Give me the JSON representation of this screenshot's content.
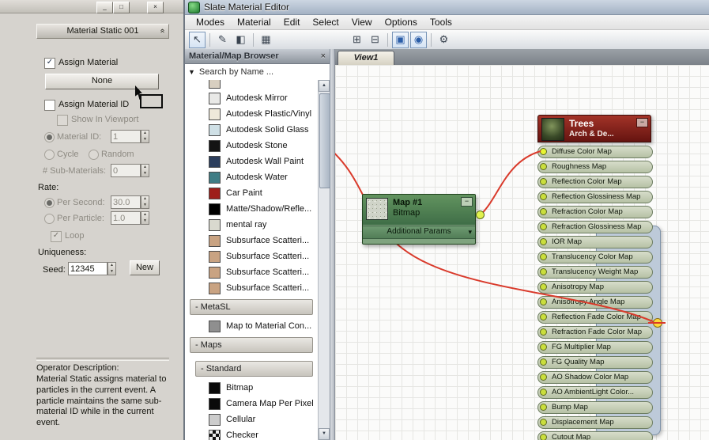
{
  "icons": {
    "check": "✓",
    "collapse_chevron": "«",
    "minus": "−",
    "spinner_up": "▲",
    "spinner_down": "▼",
    "filter_arrow": "▼",
    "close_x": "×",
    "window_minimize": "_",
    "window_maximize": "□",
    "window_close": "×",
    "expand_arrow": "▾",
    "scroll_up": "▲",
    "scroll_down": "▼"
  },
  "left_panel": {
    "rollout_title": "Material Static 001",
    "assign_material": "Assign Material",
    "none_button": "None",
    "assign_material_id": "Assign Material ID",
    "show_in_viewport": "Show In Viewport",
    "material_id_label": "Material ID:",
    "material_id_value": "1",
    "cycle": "Cycle",
    "random": "Random",
    "sub_materials_label": "# Sub-Materials:",
    "sub_materials_value": "0",
    "rate_label": "Rate:",
    "per_second": "Per Second:",
    "per_second_value": "30.0",
    "per_particle": "Per Particle:",
    "per_particle_value": "1.0",
    "loop": "Loop",
    "uniqueness_label": "Uniqueness:",
    "seed_label": "Seed:",
    "seed_value": "12345",
    "new_button": "New",
    "description_title": "Operator Description:",
    "description_text": "Material Static assigns material to particles in the current event.  A particle maintains the same sub-material ID while in the current event."
  },
  "window": {
    "title": "Slate Material Editor"
  },
  "menubar": [
    "Modes",
    "Material",
    "Edit",
    "Select",
    "View",
    "Options",
    "Tools"
  ],
  "toolbar": [
    {
      "name": "select-tool",
      "glyph": "↖",
      "active": true
    },
    {
      "sep": true
    },
    {
      "name": "pick-material-from-object",
      "glyph": "✎"
    },
    {
      "name": "assign-material-to-selection",
      "glyph": "◧"
    },
    {
      "sep": true
    },
    {
      "name": "put-to-library",
      "glyph": "▦"
    },
    {
      "gap": true
    },
    {
      "name": "layout-all",
      "glyph": "⊞"
    },
    {
      "name": "layout-children",
      "glyph": "⊟"
    },
    {
      "sep": true
    },
    {
      "name": "show-shaded-material-in-viewport",
      "glyph": "▣",
      "active": true,
      "blue": true
    },
    {
      "name": "show-end-result",
      "glyph": "◉",
      "active": true,
      "blue": true
    },
    {
      "sep": true
    },
    {
      "name": "options-gear",
      "glyph": "⚙"
    }
  ],
  "browser": {
    "title": "Material/Map Browser",
    "search_text": "Search by Name ...",
    "items": [
      {
        "type": "item",
        "partial": true,
        "label": "",
        "icon": "material-sphere-icon",
        "color": "#d8cfc0"
      },
      {
        "type": "item",
        "label": "Autodesk Mirror",
        "icon": "material-sphere-icon",
        "color": "#e9e9e7"
      },
      {
        "type": "item",
        "label": "Autodesk Plastic/Vinyl",
        "icon": "material-sphere-icon",
        "color": "#efe9da"
      },
      {
        "type": "item",
        "label": "Autodesk Solid Glass",
        "icon": "material-sphere-icon",
        "color": "#cfe0e6"
      },
      {
        "type": "item",
        "label": "Autodesk Stone",
        "icon": "material-sphere-icon",
        "color": "#141414"
      },
      {
        "type": "item",
        "label": "Autodesk Wall Paint",
        "icon": "material-sphere-icon",
        "color": "#2c3e5c"
      },
      {
        "type": "item",
        "label": "Autodesk Water",
        "icon": "material-sphere-icon",
        "color": "#3f7d85"
      },
      {
        "type": "item",
        "label": "Car Paint",
        "icon": "material-sphere-icon",
        "color": "#9e1f1a"
      },
      {
        "type": "item",
        "label": "Matte/Shadow/Refle...",
        "icon": "material-sphere-icon",
        "color": "#000000"
      },
      {
        "type": "item",
        "label": "mental ray",
        "icon": "material-sphere-icon",
        "color": "#d9d9cf"
      },
      {
        "type": "item",
        "label": "Subsurface Scatteri...",
        "icon": "material-sphere-icon",
        "color": "#c9a382"
      },
      {
        "type": "item",
        "label": "Subsurface Scatteri...",
        "icon": "material-sphere-icon",
        "color": "#c9a382"
      },
      {
        "type": "item",
        "label": "Subsurface Scatteri...",
        "icon": "material-sphere-icon",
        "color": "#c9a382"
      },
      {
        "type": "item",
        "label": "Subsurface Scatteri...",
        "icon": "material-sphere-icon",
        "color": "#c9a382"
      },
      {
        "type": "group",
        "label": "- MetaSL"
      },
      {
        "type": "item",
        "label": "Map to Material Con...",
        "icon": "map-icon",
        "color": "#8f8f8f"
      },
      {
        "type": "group",
        "label": "- Maps"
      },
      {
        "type": "group",
        "label": "- Standard",
        "indent": true,
        "spaced": true
      },
      {
        "type": "item",
        "label": "Bitmap",
        "icon": "map-icon",
        "color": "#0a0a0a"
      },
      {
        "type": "item",
        "label": "Camera Map Per Pixel",
        "icon": "map-icon",
        "color": "#0a0a0a"
      },
      {
        "type": "item",
        "label": "Cellular",
        "icon": "map-icon",
        "color": "#cccccc"
      },
      {
        "type": "item",
        "label": "Checker",
        "icon": "checker-map-icon",
        "color": "checker"
      }
    ]
  },
  "view": {
    "tab_label": "View1",
    "nodes": {
      "bitmap": {
        "title": "Map #1",
        "subtitle": "Bitmap",
        "params_label": "Additional Params"
      },
      "trees": {
        "title": "Trees",
        "subtitle": "Arch & De...",
        "slots": [
          "Diffuse Color Map",
          "Roughness Map",
          "Reflection Color Map",
          "Reflection Glossiness Map",
          "Refraction Color Map",
          "Refraction Glossiness Map",
          "IOR Map",
          "Translucency Color Map",
          "Translucency Weight Map",
          "Anisotropy Map",
          "Anisotropy Angle Map",
          "Reflection Fade Color Map",
          "Refraction Fade Color Map",
          "FG Multiplier Map",
          "FG Quality Map",
          "AO Shadow Color Map",
          "AO AmbientLight Color...",
          "Bump Map",
          "Displacement Map",
          "Cutout Map"
        ]
      }
    },
    "connections": [
      {
        "from": "Map #1 Bitmap output",
        "to": "Trees Diffuse Color Map input"
      },
      {
        "from": "off-screen left",
        "to": "Trees material output socket"
      }
    ]
  },
  "colors": {
    "wire_red": "#d93a2b",
    "socket_yellow_green": "#cade3d",
    "output_yellow": "#ffd83a",
    "node_green_header": "#4f7d55",
    "node_red_header": "#8a241b",
    "node_body_blue": "#bdcad9"
  }
}
